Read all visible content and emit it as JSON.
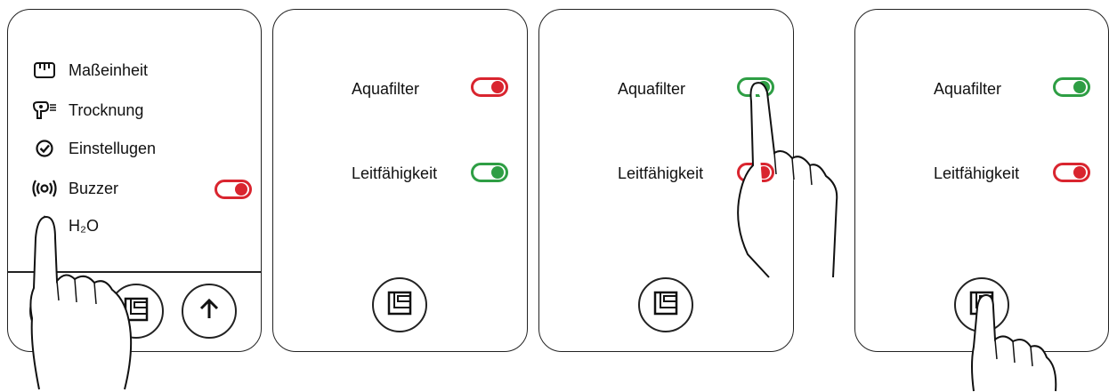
{
  "panel1": {
    "menu": [
      {
        "icon": "ruler-icon",
        "label": "Maßeinheit"
      },
      {
        "icon": "hairdryer-icon",
        "label": "Trocknung"
      },
      {
        "icon": "check-circle-icon",
        "label": "Einstellugen"
      },
      {
        "icon": "broadcast-icon",
        "label": "Buzzer",
        "toggle": "off"
      },
      {
        "icon": "water-drop-icon",
        "label": "H₂O"
      }
    ],
    "bottom_buttons": [
      "power-icon",
      "filter-box-icon",
      "arrow-up-icon"
    ]
  },
  "panel2": {
    "aquafilter_label": "Aquafilter",
    "aquafilter_state": "off",
    "leitfaehigkeit_label": "Leitfähigkeit",
    "leitfaehigkeit_state": "on"
  },
  "panel3": {
    "aquafilter_label": "Aquafilter",
    "aquafilter_state": "on",
    "leitfaehigkeit_label": "Leitfähigkeit",
    "leitfaehigkeit_state": "off"
  },
  "panel4": {
    "aquafilter_label": "Aquafilter",
    "aquafilter_state": "on",
    "leitfaehigkeit_label": "Leitfähigkeit",
    "leitfaehigkeit_state": "off"
  },
  "colors": {
    "toggle_on": "#2e9e44",
    "toggle_off": "#d9252f",
    "line": "#222222"
  }
}
